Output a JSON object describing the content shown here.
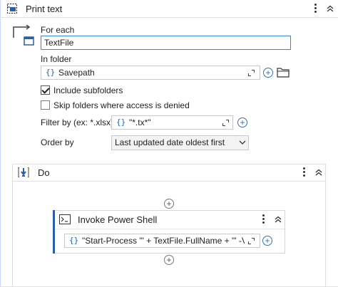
{
  "print_text": {
    "title": "Print text"
  },
  "for_each": {
    "label": "For each",
    "variable_value": "TextFile",
    "in_folder_label": "In folder",
    "in_folder_value": "Savepath",
    "include_subfolders_label": "Include subfolders",
    "include_subfolders_checked": true,
    "skip_denied_label": "Skip folders where access is denied",
    "skip_denied_checked": false,
    "filter_label": "Filter by (ex: *.xlsx)",
    "filter_value": "\"*.tx*\"",
    "order_label": "Order by",
    "order_value": "Last updated date oldest first"
  },
  "do_block": {
    "title": "Do"
  },
  "invoke": {
    "title": "Invoke Power Shell",
    "expression": "\"Start-Process '\" + TextFile.FullName + \"' -Ve"
  },
  "icons": {
    "brace": "{}"
  }
}
